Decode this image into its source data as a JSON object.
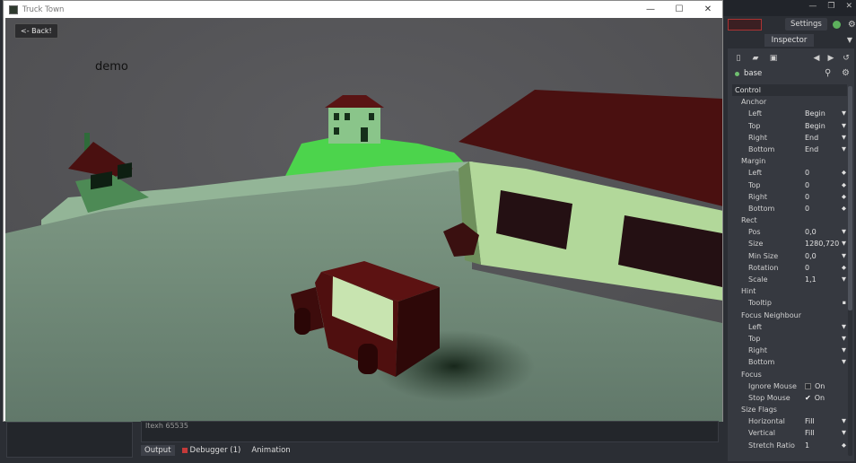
{
  "window": {
    "title": "Truck Town"
  },
  "window_controls": {
    "minimize": "—",
    "maximize": "☐",
    "close": "✕"
  },
  "editor_controls": {
    "minimize": "—",
    "restore": "❐",
    "close": "✕"
  },
  "game": {
    "back_button": "<- Back!",
    "demo_label": "demo"
  },
  "settings": {
    "label": "Settings"
  },
  "inspector": {
    "tab": "Inspector",
    "object_name": "base",
    "sections": [
      {
        "type": "section",
        "label": "Control"
      },
      {
        "type": "group",
        "label": "Anchor"
      },
      {
        "type": "prop",
        "name": "Left",
        "value": "Begin",
        "ctrl": "▼"
      },
      {
        "type": "prop",
        "name": "Top",
        "value": "Begin",
        "ctrl": "▼"
      },
      {
        "type": "prop",
        "name": "Right",
        "value": "End",
        "ctrl": "▼"
      },
      {
        "type": "prop",
        "name": "Bottom",
        "value": "End",
        "ctrl": "▼"
      },
      {
        "type": "group",
        "label": "Margin"
      },
      {
        "type": "prop",
        "name": "Left",
        "value": "0",
        "ctrl": "◆"
      },
      {
        "type": "prop",
        "name": "Top",
        "value": "0",
        "ctrl": "◆"
      },
      {
        "type": "prop",
        "name": "Right",
        "value": "0",
        "ctrl": "◆"
      },
      {
        "type": "prop",
        "name": "Bottom",
        "value": "0",
        "ctrl": "◆"
      },
      {
        "type": "group",
        "label": "Rect"
      },
      {
        "type": "prop",
        "name": "Pos",
        "value": "0,0",
        "ctrl": "▼"
      },
      {
        "type": "prop",
        "name": "Size",
        "value": "1280,720",
        "ctrl": "▼"
      },
      {
        "type": "prop",
        "name": "Min Size",
        "value": "0,0",
        "ctrl": "▼"
      },
      {
        "type": "prop",
        "name": "Rotation",
        "value": "0",
        "ctrl": "◆"
      },
      {
        "type": "prop",
        "name": "Scale",
        "value": "1,1",
        "ctrl": "▼"
      },
      {
        "type": "group",
        "label": "Hint"
      },
      {
        "type": "prop",
        "name": "Tooltip",
        "value": "",
        "ctrl": "▪"
      },
      {
        "type": "group",
        "label": "Focus Neighbour"
      },
      {
        "type": "prop",
        "name": "Left",
        "value": "",
        "ctrl": "▼"
      },
      {
        "type": "prop",
        "name": "Top",
        "value": "",
        "ctrl": "▼"
      },
      {
        "type": "prop",
        "name": "Right",
        "value": "",
        "ctrl": "▼"
      },
      {
        "type": "prop",
        "name": "Bottom",
        "value": "",
        "ctrl": "▼"
      },
      {
        "type": "group",
        "label": "Focus"
      },
      {
        "type": "check",
        "name": "Ignore Mouse",
        "value": "On",
        "checked": false
      },
      {
        "type": "check",
        "name": "Stop Mouse",
        "value": "On",
        "checked": true
      },
      {
        "type": "group",
        "label": "Size Flags"
      },
      {
        "type": "prop",
        "name": "Horizontal",
        "value": "Fill",
        "ctrl": "▼"
      },
      {
        "type": "prop",
        "name": "Vertical",
        "value": "Fill",
        "ctrl": "▼"
      },
      {
        "type": "prop",
        "name": "Stretch Ratio",
        "value": "1",
        "ctrl": "◆"
      }
    ]
  },
  "output": {
    "text": "ltexh 65535"
  },
  "bottom_tabs": [
    {
      "label": "Output",
      "active": true
    },
    {
      "label": "Debugger (1)",
      "active": false
    },
    {
      "label": "Animation",
      "active": false
    }
  ],
  "colors": {
    "accent_red": "#c43a3a",
    "status_green": "#5db15d",
    "panel": "#363940"
  }
}
